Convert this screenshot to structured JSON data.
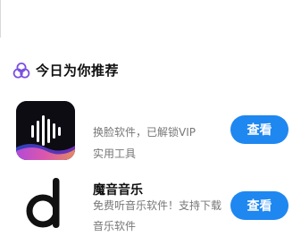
{
  "section": {
    "title": "今日为你推荐",
    "icon": "triple-circle-icon"
  },
  "apps": [
    {
      "name": "",
      "desc": "换脸软件，已解锁VIP",
      "category": "实用工具",
      "button": "查看",
      "icon": "waveform-app-icon"
    },
    {
      "name": "魔音音乐",
      "desc": "免费听音乐软件！支持下载",
      "category": "音乐软件",
      "button": "查看",
      "icon": "letter-d-app-icon"
    }
  ],
  "colors": {
    "accent": "#1f87f0",
    "icon_purple": "#7a4fe0"
  }
}
